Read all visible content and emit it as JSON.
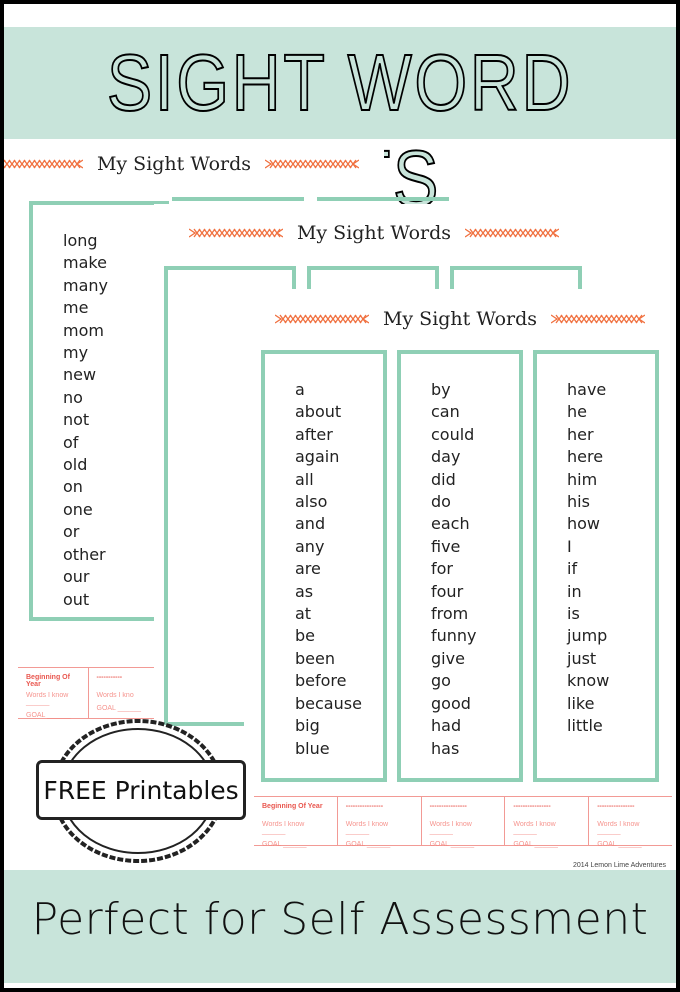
{
  "header": {
    "title": "SIGHT WORD LISTS"
  },
  "footer": {
    "tagline": "Perfect for Self Assessment",
    "copyright": "2014 Lemon Lime Adventures"
  },
  "stamp": {
    "label": "FREE Printables"
  },
  "colors": {
    "banner": "#c8e4da",
    "box_border": "#8fcfb5",
    "stitch": "#f0703f",
    "assessment": "#f29a95"
  },
  "sheets": [
    {
      "title": "My Sight Words",
      "columns": [
        [
          "long",
          "make",
          "many",
          "me",
          "mom",
          "my",
          "new",
          "no",
          "not",
          "of",
          "old",
          "on",
          "one",
          "or",
          "other",
          "our",
          "out"
        ]
      ],
      "assessment": [
        {
          "heading": "Beginning Of Year",
          "words_label": "Words I know ______",
          "goal_label": "GOAL ______"
        },
        {
          "heading": "-----------",
          "words_label": "Words I kno",
          "goal_label": "GOAL ______"
        }
      ]
    },
    {
      "title": "My Sight Words",
      "assessment_heading_fragment": "Year"
    },
    {
      "title": "My Sight Words",
      "columns": [
        [
          "a",
          "about",
          "after",
          "again",
          "all",
          "also",
          "and",
          "any",
          "are",
          "as",
          "at",
          "be",
          "been",
          "before",
          "because",
          "big",
          "blue"
        ],
        [
          "by",
          "can",
          "could",
          "day",
          "did",
          "do",
          "each",
          "five",
          "for",
          "four",
          "from",
          "funny",
          "give",
          "go",
          "good",
          "had",
          "has"
        ],
        [
          "have",
          "he",
          "her",
          "here",
          "him",
          "his",
          "how",
          "I",
          "if",
          "in",
          "is",
          "jump",
          "just",
          "know",
          "like",
          "little"
        ]
      ],
      "assessment": [
        {
          "heading": "Beginning Of Year",
          "words_label": "Words I know ______",
          "goal_label": "GOAL ______"
        },
        {
          "heading": "----------------",
          "words_label": "Words I know ______",
          "goal_label": "GOAL ______"
        },
        {
          "heading": "----------------",
          "words_label": "Words I know ______",
          "goal_label": "GOAL ______"
        },
        {
          "heading": "----------------",
          "words_label": "Words I know ______",
          "goal_label": "GOAL ______"
        },
        {
          "heading": "----------------",
          "words_label": "Words I know ______",
          "goal_label": "GOAL ______"
        }
      ]
    }
  ]
}
